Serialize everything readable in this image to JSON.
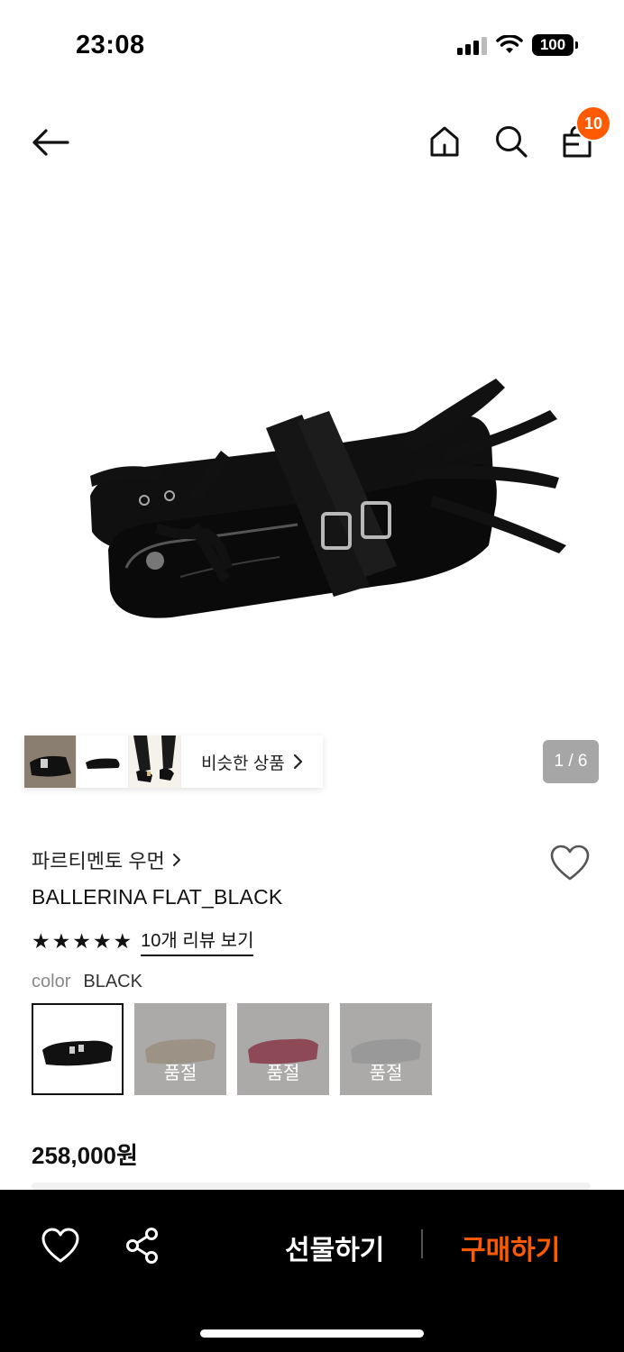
{
  "status": {
    "time": "23:08",
    "battery": "100"
  },
  "nav": {
    "cart_count": "10"
  },
  "gallery": {
    "similar_label": "비슷한 상품",
    "page_indicator": "1 / 6"
  },
  "product": {
    "brand": "파르티멘토 우먼",
    "title": "BALLERINA FLAT_BLACK",
    "rating_stars": 5,
    "review_link": "10개 리뷰 보기",
    "color_label": "color",
    "color_value": "BLACK",
    "swatches": [
      {
        "color": "BLACK",
        "soldout": false
      },
      {
        "color": "beige",
        "soldout": true,
        "label": "품절"
      },
      {
        "color": "red",
        "soldout": true,
        "label": "품절"
      },
      {
        "color": "silver",
        "soldout": true,
        "label": "품절"
      }
    ],
    "price": "258,000원"
  },
  "bottom_bar": {
    "gift_label": "선물하기",
    "buy_label": "구매하기"
  },
  "colors": {
    "accent": "#ff5a00",
    "page_indicator_bg": "#a6a6a6",
    "bottom_bar_bg": "#000000"
  }
}
